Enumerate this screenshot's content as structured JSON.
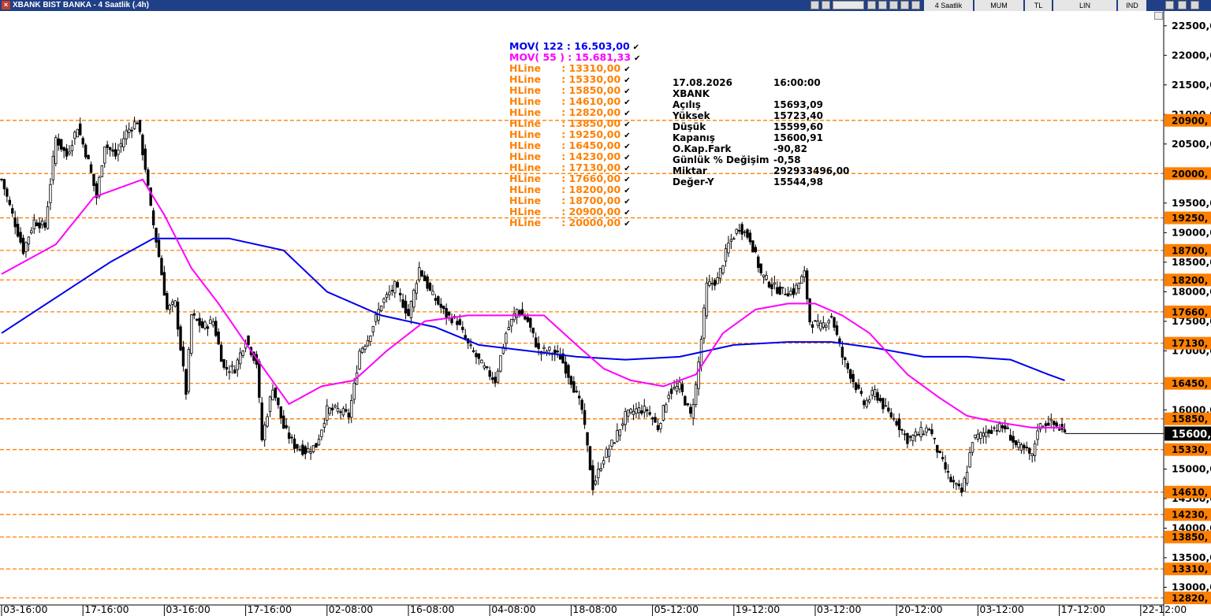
{
  "window": {
    "title": "XBANK BIST BANKA - 4 Saatlik (.4h)"
  },
  "toolbar": {
    "period": "4 Saatlik",
    "chart_type": "MUM",
    "currency": "TL",
    "scale": "LIN",
    "indicators": "IND"
  },
  "legend": [
    {
      "name": "MOV( 122 : 16.503,00",
      "color": "#0000ee"
    },
    {
      "name": "MOV( 55 ) : 15.681,33",
      "color": "#ff00ff"
    },
    {
      "name": "HLine      : 13310,00",
      "color": "#ff8000"
    },
    {
      "name": "HLine      : 15330,00",
      "color": "#ff8000"
    },
    {
      "name": "HLine      : 15850,00",
      "color": "#ff8000"
    },
    {
      "name": "HLine      : 14610,00",
      "color": "#ff8000"
    },
    {
      "name": "HLine      : 12820,00",
      "color": "#ff8000"
    },
    {
      "name": "HLine      : 13850,00",
      "color": "#ff8000"
    },
    {
      "name": "HLine      : 19250,00",
      "color": "#ff8000"
    },
    {
      "name": "HLine      : 16450,00",
      "color": "#ff8000"
    },
    {
      "name": "HLine      : 14230,00",
      "color": "#ff8000"
    },
    {
      "name": "HLine      : 17130,00",
      "color": "#ff8000"
    },
    {
      "name": "HLine      : 17660,00",
      "color": "#ff8000"
    },
    {
      "name": "HLine      : 18200,00",
      "color": "#ff8000"
    },
    {
      "name": "HLine      : 18700,00",
      "color": "#ff8000"
    },
    {
      "name": "HLine      : 20900,00",
      "color": "#ff8000"
    },
    {
      "name": "HLine      : 20000,00",
      "color": "#ff8000"
    }
  ],
  "info": {
    "date": "17.08.2026",
    "time": "16:00:00",
    "symbol": "XBANK",
    "rows": [
      {
        "label": "Açılış",
        "value": "15693,09"
      },
      {
        "label": "Yüksek",
        "value": "15723,40"
      },
      {
        "label": "Düşük",
        "value": "15599,60"
      },
      {
        "label": "Kapanış",
        "value": "15600,91"
      },
      {
        "label": "O.Kap.Fark",
        "value": "-90,82"
      },
      {
        "label": "Günlük % Değişim",
        "value": "-0,58"
      },
      {
        "label": "Miktar",
        "value": "292933496,00"
      },
      {
        "label": "Değer-Y",
        "value": "15544,98"
      }
    ]
  },
  "chart_data": {
    "type": "candlestick",
    "title": "XBANK BIST BANKA - 4 Saatlik (.4h)",
    "ylim": [
      12700,
      22750
    ],
    "y_ticks": [
      "22500,0",
      "22000,0",
      "21500,0",
      "21000,0",
      "20500,0",
      "19500,0",
      "19000,0",
      "18500,0",
      "18000,0",
      "17500,0",
      "17000,0",
      "16000,0",
      "15000,0",
      "14500,0",
      "14000,0",
      "13500,0",
      "13000,0"
    ],
    "y_tick_values": [
      22500,
      22000,
      21500,
      21000,
      20500,
      19500,
      19000,
      18500,
      18000,
      17500,
      17000,
      16000,
      15000,
      14500,
      14000,
      13500,
      13000
    ],
    "x_ticks": [
      "03-16:00",
      "17-16:00",
      "03-16:00",
      "17-16:00",
      "02-08:00",
      "16-08:00",
      "04-08:00",
      "18-08:00",
      "05-12:00",
      "19-12:00",
      "03-12:00",
      "20-12:00",
      "03-12:00",
      "17-12:00",
      "22-12:00"
    ],
    "x_tick_index": [
      0,
      30,
      60,
      90,
      120,
      150,
      180,
      210,
      240,
      270,
      300,
      330,
      360,
      390,
      420
    ],
    "hlines": [
      20900,
      20000,
      19250,
      18700,
      18200,
      17660,
      17130,
      16450,
      15850,
      15330,
      14610,
      14230,
      13850,
      13310,
      12820
    ],
    "hline_labels": [
      "20900,",
      "20000,",
      "19250,",
      "18700,",
      "18200,",
      "17660,",
      "17130,",
      "16450,",
      "15850,",
      "15330,",
      "14610,",
      "14230,",
      "13850,",
      "13310,",
      "12820,"
    ],
    "last_price_label": "15600,",
    "last_price": 15600,
    "key_closes": [
      [
        0,
        19900
      ],
      [
        4,
        19300
      ],
      [
        8,
        18700
      ],
      [
        12,
        19200
      ],
      [
        16,
        19100
      ],
      [
        20,
        20600
      ],
      [
        24,
        20300
      ],
      [
        28,
        20800
      ],
      [
        32,
        20200
      ],
      [
        35,
        19600
      ],
      [
        38,
        20500
      ],
      [
        42,
        20300
      ],
      [
        46,
        20700
      ],
      [
        50,
        20900
      ],
      [
        53,
        20100
      ],
      [
        55,
        19400
      ],
      [
        58,
        18600
      ],
      [
        61,
        17700
      ],
      [
        64,
        17800
      ],
      [
        68,
        16300
      ],
      [
        70,
        17600
      ],
      [
        74,
        17400
      ],
      [
        78,
        17500
      ],
      [
        82,
        16700
      ],
      [
        86,
        16700
      ],
      [
        90,
        17200
      ],
      [
        94,
        16800
      ],
      [
        96,
        15500
      ],
      [
        100,
        16400
      ],
      [
        104,
        15700
      ],
      [
        108,
        15400
      ],
      [
        112,
        15300
      ],
      [
        116,
        15400
      ],
      [
        120,
        16000
      ],
      [
        124,
        16000
      ],
      [
        128,
        15900
      ],
      [
        130,
        16400
      ],
      [
        132,
        17000
      ],
      [
        135,
        17200
      ],
      [
        140,
        17800
      ],
      [
        145,
        18100
      ],
      [
        150,
        17600
      ],
      [
        154,
        18400
      ],
      [
        158,
        18000
      ],
      [
        164,
        17600
      ],
      [
        168,
        17500
      ],
      [
        172,
        17100
      ],
      [
        178,
        16700
      ],
      [
        182,
        16500
      ],
      [
        186,
        17300
      ],
      [
        190,
        17700
      ],
      [
        194,
        17500
      ],
      [
        198,
        17000
      ],
      [
        202,
        17000
      ],
      [
        206,
        16900
      ],
      [
        210,
        16500
      ],
      [
        214,
        16000
      ],
      [
        218,
        14700
      ],
      [
        222,
        15200
      ],
      [
        226,
        15500
      ],
      [
        230,
        15900
      ],
      [
        234,
        16000
      ],
      [
        238,
        16000
      ],
      [
        242,
        15700
      ],
      [
        246,
        16300
      ],
      [
        250,
        16400
      ],
      [
        254,
        15900
      ],
      [
        256,
        16400
      ],
      [
        258,
        17200
      ],
      [
        260,
        18100
      ],
      [
        264,
        18200
      ],
      [
        268,
        18800
      ],
      [
        272,
        19100
      ],
      [
        276,
        18900
      ],
      [
        280,
        18300
      ],
      [
        284,
        18100
      ],
      [
        288,
        18000
      ],
      [
        292,
        18000
      ],
      [
        296,
        18300
      ],
      [
        298,
        17500
      ],
      [
        302,
        17400
      ],
      [
        306,
        17600
      ],
      [
        310,
        16900
      ],
      [
        314,
        16500
      ],
      [
        318,
        16100
      ],
      [
        322,
        16300
      ],
      [
        326,
        16000
      ],
      [
        330,
        15800
      ],
      [
        334,
        15500
      ],
      [
        338,
        15600
      ],
      [
        342,
        15700
      ],
      [
        346,
        15200
      ],
      [
        350,
        14800
      ],
      [
        354,
        14600
      ],
      [
        356,
        15000
      ],
      [
        358,
        15500
      ],
      [
        362,
        15600
      ],
      [
        366,
        15700
      ],
      [
        370,
        15700
      ],
      [
        374,
        15400
      ],
      [
        378,
        15300
      ],
      [
        380,
        15200
      ],
      [
        382,
        15700
      ],
      [
        386,
        15800
      ],
      [
        390,
        15700
      ],
      [
        392,
        15600
      ]
    ],
    "mov55_points": [
      [
        0,
        18300
      ],
      [
        20,
        18800
      ],
      [
        34,
        19600
      ],
      [
        40,
        19700
      ],
      [
        52,
        19900
      ],
      [
        60,
        19300
      ],
      [
        70,
        18400
      ],
      [
        80,
        17800
      ],
      [
        92,
        17000
      ],
      [
        106,
        16100
      ],
      [
        118,
        16400
      ],
      [
        130,
        16500
      ],
      [
        142,
        17000
      ],
      [
        156,
        17500
      ],
      [
        172,
        17600
      ],
      [
        186,
        17600
      ],
      [
        200,
        17600
      ],
      [
        212,
        17100
      ],
      [
        222,
        16700
      ],
      [
        232,
        16500
      ],
      [
        244,
        16400
      ],
      [
        256,
        16600
      ],
      [
        266,
        17300
      ],
      [
        278,
        17700
      ],
      [
        290,
        17800
      ],
      [
        300,
        17800
      ],
      [
        310,
        17600
      ],
      [
        320,
        17300
      ],
      [
        334,
        16600
      ],
      [
        346,
        16200
      ],
      [
        356,
        15900
      ],
      [
        366,
        15800
      ],
      [
        380,
        15700
      ],
      [
        392,
        15700
      ]
    ],
    "mov122_points": [
      [
        0,
        17300
      ],
      [
        20,
        17900
      ],
      [
        40,
        18500
      ],
      [
        56,
        18900
      ],
      [
        70,
        18900
      ],
      [
        84,
        18900
      ],
      [
        104,
        18700
      ],
      [
        120,
        18000
      ],
      [
        140,
        17600
      ],
      [
        160,
        17400
      ],
      [
        176,
        17100
      ],
      [
        194,
        17000
      ],
      [
        212,
        16900
      ],
      [
        230,
        16850
      ],
      [
        250,
        16900
      ],
      [
        270,
        17100
      ],
      [
        290,
        17150
      ],
      [
        306,
        17150
      ],
      [
        322,
        17050
      ],
      [
        340,
        16900
      ],
      [
        356,
        16900
      ],
      [
        372,
        16850
      ],
      [
        386,
        16600
      ],
      [
        392,
        16500
      ]
    ],
    "colors": {
      "candle": "#000000",
      "mov122": "#0000ee",
      "mov55": "#ff00ff",
      "hline": "#ff8000",
      "label_bg": "#ff8000"
    }
  }
}
